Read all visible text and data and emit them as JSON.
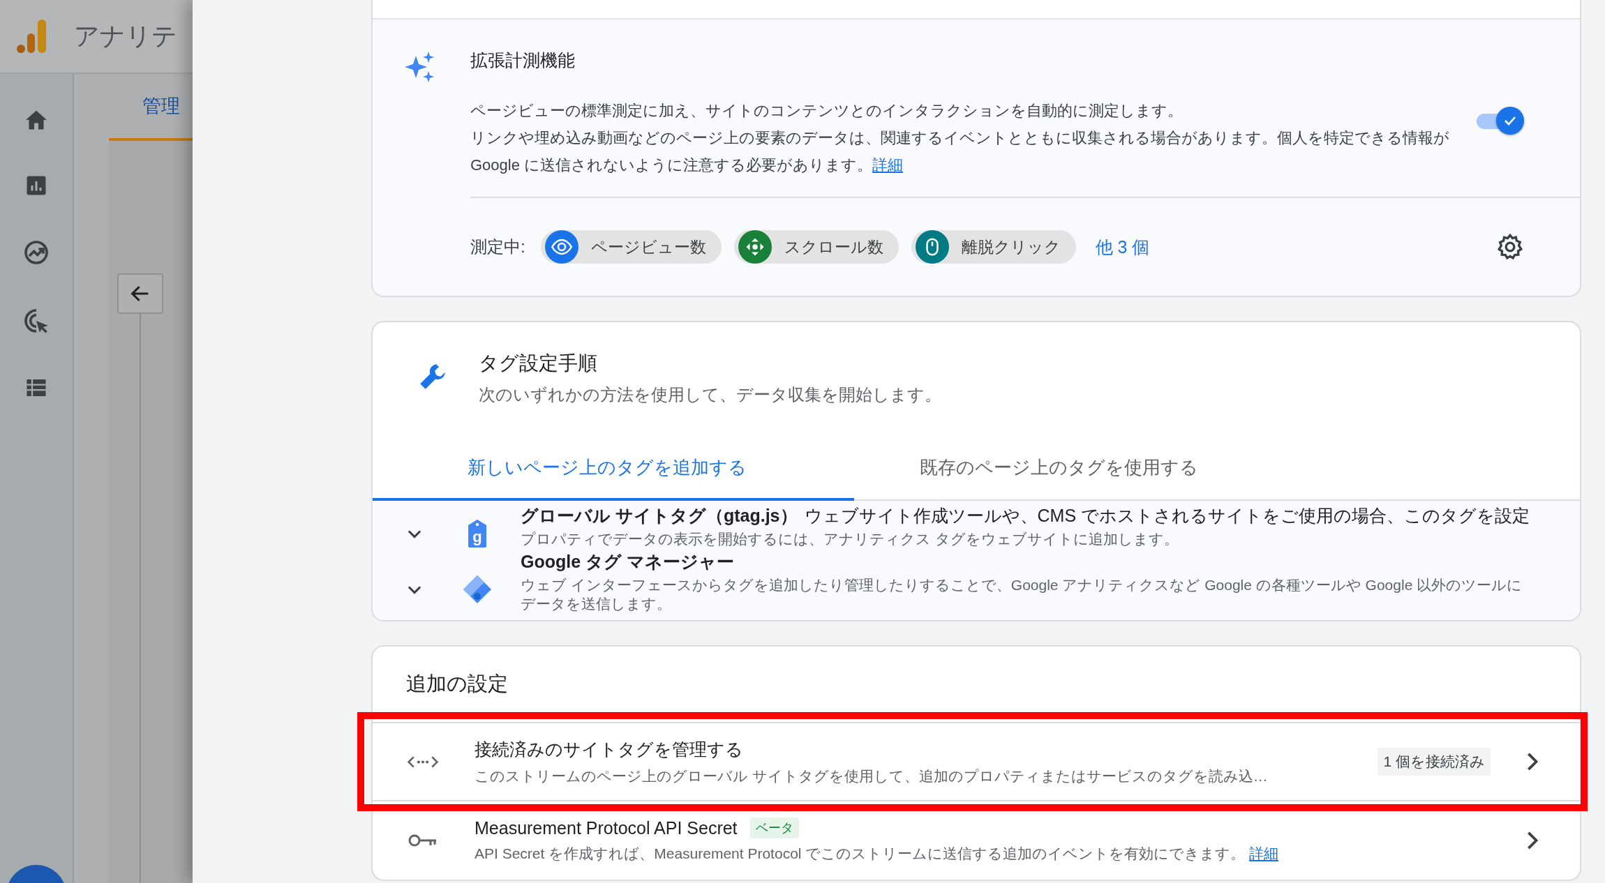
{
  "background_app": {
    "title": "アナリテ",
    "tab": "管理"
  },
  "enhanced_measurement": {
    "title": "拡張計測機能",
    "paragraphs": [
      "ページビューの標準測定に加え、サイトのコンテンツとのインタラクションを自動的に測定します。",
      "リンクや埋め込み動画などのページ上の要素のデータは、関連するイベントとともに収集される場合があります。個人を特定できる情報が Google に送信されないように注意する必要があります。"
    ],
    "link": "詳細",
    "on": true,
    "measuring_label": "測定中:",
    "chips": [
      {
        "kind": "eye",
        "label": "ページビュー数",
        "color": "#1a73e8"
      },
      {
        "kind": "scroll",
        "label": "スクロール数",
        "color": "#188038"
      },
      {
        "kind": "mouse",
        "label": "離脱クリック",
        "color": "#007b83"
      }
    ],
    "more": "他 3 個"
  },
  "tag_setup": {
    "title": "タグ設定手順",
    "subtitle": "次のいずれかの方法を使用して、データ収集を開始します。",
    "tabs": [
      {
        "label": "新しいページ上のタグを追加する",
        "selected": true
      },
      {
        "label": "既存のページ上のタグを使用する",
        "selected": false
      }
    ],
    "options": [
      {
        "kind": "gtag",
        "icon_letter": "g",
        "title": "グローバル サイトタグ（gtag.js）",
        "note": "ウェブサイト作成ツールや、CMS でホストされるサイトをご使用の場合、このタグを設定",
        "description": "プロパティでデータの表示を開始するには、アナリティクス タグをウェブサイトに追加します。",
        "expanded": false
      },
      {
        "kind": "gtm",
        "title": "Google タグ マネージャー",
        "description": "ウェブ インターフェースからタグを追加したり管理したりすることで、Google アナリティクスなど Google の各種ツールや Google 以外のツールにデータを送信します。",
        "expanded": false
      }
    ]
  },
  "additional_settings": {
    "title": "追加の設定",
    "items": [
      {
        "kind": "code",
        "title": "接続済みのサイトタグを管理する",
        "description": "このストリームのページ上のグローバル サイトタグを使用して、追加のプロパティまたはサービスのタグを読み込…",
        "status": "1 個を接続済み",
        "highlighted": true
      },
      {
        "kind": "key",
        "title": "Measurement Protocol API Secret",
        "badge": "ベータ",
        "description": "API Secret を作成すれば、Measurement Protocol でこのストリームに送信する追加のイベントを有効にできます。",
        "link": "詳細",
        "highlighted": false
      }
    ]
  }
}
